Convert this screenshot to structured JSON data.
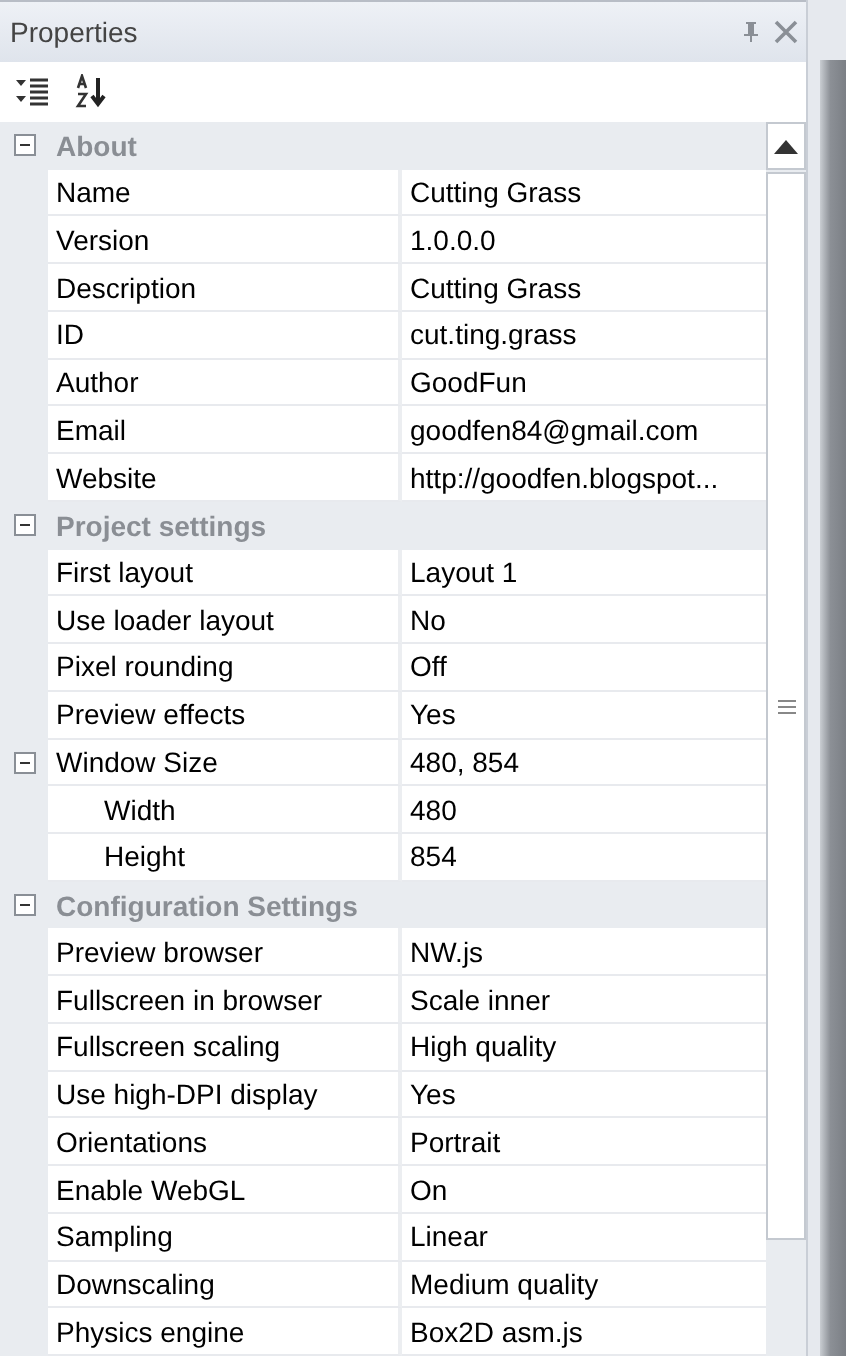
{
  "panel": {
    "title": "Properties"
  },
  "categories": [
    {
      "label": "About",
      "expanded": true,
      "rows": [
        {
          "name": "Name",
          "value": "Cutting Grass"
        },
        {
          "name": "Version",
          "value": "1.0.0.0"
        },
        {
          "name": "Description",
          "value": "Cutting Grass"
        },
        {
          "name": "ID",
          "value": "cut.ting.grass"
        },
        {
          "name": "Author",
          "value": "GoodFun"
        },
        {
          "name": "Email",
          "value": "goodfen84@gmail.com"
        },
        {
          "name": "Website",
          "value": "http://goodfen.blogspot..."
        }
      ]
    },
    {
      "label": "Project settings",
      "expanded": true,
      "rows": [
        {
          "name": "First layout",
          "value": "Layout 1"
        },
        {
          "name": "Use loader layout",
          "value": "No"
        },
        {
          "name": "Pixel rounding",
          "value": "Off"
        },
        {
          "name": "Preview effects",
          "value": "Yes"
        },
        {
          "name": "Window Size",
          "value": "480, 854",
          "expanded": true,
          "children": [
            {
              "name": "Width",
              "value": "480"
            },
            {
              "name": "Height",
              "value": "854"
            }
          ]
        }
      ]
    },
    {
      "label": "Configuration Settings",
      "expanded": true,
      "rows": [
        {
          "name": "Preview browser",
          "value": "NW.js"
        },
        {
          "name": "Fullscreen in browser",
          "value": "Scale inner"
        },
        {
          "name": "Fullscreen scaling",
          "value": "High quality"
        },
        {
          "name": "Use high-DPI display",
          "value": "Yes"
        },
        {
          "name": "Orientations",
          "value": "Portrait"
        },
        {
          "name": "Enable WebGL",
          "value": "On"
        },
        {
          "name": "Sampling",
          "value": "Linear"
        },
        {
          "name": "Downscaling",
          "value": "Medium quality"
        },
        {
          "name": "Physics engine",
          "value": "Box2D asm.js"
        }
      ]
    }
  ]
}
